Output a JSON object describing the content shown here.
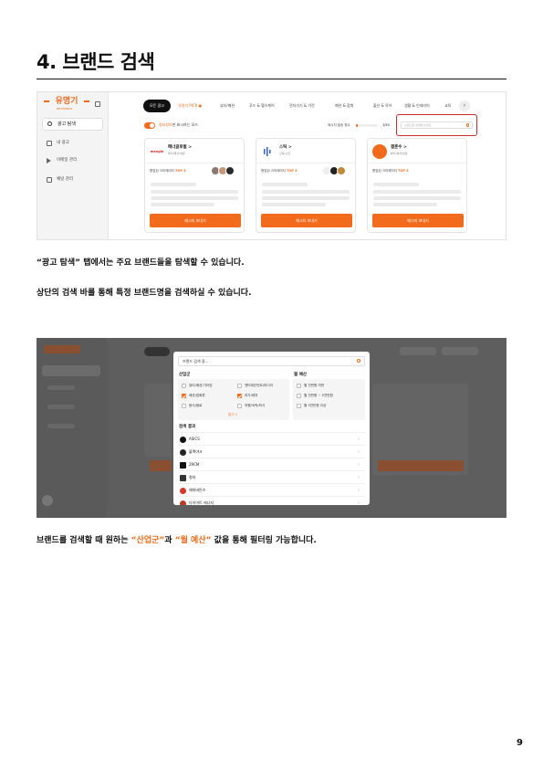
{
  "section_title": "4. 브랜드 검색",
  "screenshot1": {
    "logo": "유명기",
    "logo_sub": "NETWORKS",
    "sidebar": {
      "search_label": "광고 탐색",
      "items": [
        "내 광고",
        "이메일 관리",
        "채널 관리"
      ]
    },
    "tabs": [
      "모든 광고",
      "유명기 PICK",
      "뷰티/패션",
      "푸드 & 헬스케어",
      "전자기기 & 가전",
      "패션 & 잡화",
      "출산 & 육아",
      "생활 & 인테리어",
      "교육"
    ],
    "tab_pick_badge": "●",
    "tab_next": "›",
    "toggle_label_highlight": "중요정보",
    "toggle_label_rest": "만 표시하는 모드",
    "send_limit_label": "메시지 발송 횟수",
    "send_limit_count": "1/50",
    "send_limit_progress": 0.02,
    "search_placeholder": "브랜드를 검색해 보세요",
    "cards": [
      {
        "name": "매너글로벌 >",
        "sub": "뷰티/패션/생활",
        "category_label": "협업된 크리에이터",
        "category_rank": "TOP 3",
        "logo_color": "#ffffff",
        "logo_text": "mengle",
        "button": "메시지 보내기"
      },
      {
        "name": "스틱 >",
        "sub": "교육/출판",
        "category_label": "협업된 크리에이터",
        "category_rank": "TOP 3",
        "logo_color": "#ffffff",
        "logo_text": "",
        "button": "메시지 보내기"
      },
      {
        "name": "결혼수 >",
        "sub": "뷰티/패션/생활",
        "category_label": "협업된 크리에이터",
        "category_rank": "TOP 3",
        "logo_color": "#f26b1d",
        "logo_text": "",
        "button": "메시지 보내기"
      }
    ]
  },
  "para1": "“광고 탐색” 탭에서는 주요 브랜드들을 탐색할 수 있습니다.",
  "para2": "상단의 검색 바를 통해 특정 브랜드명을 검색하실 수 있습니다.",
  "screenshot2": {
    "search_value": "브랜드 검색 중...",
    "industry_heading": "산업군",
    "budget_heading": "월 예산",
    "industries": [
      {
        "label": "뷰티/패션/기타업",
        "checked": false
      },
      {
        "label": "패션/잡화류",
        "checked": true
      },
      {
        "label": "음식/음료",
        "checked": false
      },
      {
        "label": "엔터테인먼트/미디어",
        "checked": false
      },
      {
        "label": "여가/레저",
        "checked": true
      },
      {
        "label": "여행/숙박/외식",
        "checked": false
      }
    ],
    "budgets": [
      {
        "label": "월 천만원 미만",
        "checked": false
      },
      {
        "label": "월 천만원 ~ 5천만원",
        "checked": false
      },
      {
        "label": "월 5천만원 이상",
        "checked": false
      }
    ],
    "more_label": "접기 ∨",
    "results_heading": "검색 결과",
    "results": [
      {
        "name": "ASICS",
        "color": "#111111"
      },
      {
        "name": "블랙야크",
        "color": "#222222"
      },
      {
        "name": "29CM",
        "color": "#111111"
      },
      {
        "name": "컬처",
        "color": "#333333"
      },
      {
        "name": "해피버튼즈",
        "color": "#d9392b"
      },
      {
        "name": "다이어트 에너지",
        "color": "#c0392b"
      }
    ]
  },
  "para3": {
    "before": "브랜드를 검색할 때 원하는 ",
    "hl1": "“산업군”",
    "mid": "과 ",
    "hl2": "“월 예산”",
    "after": " 값을 통해 필터링 가능합니다."
  },
  "page_number": "9",
  "accent_color": "#f26b1d"
}
